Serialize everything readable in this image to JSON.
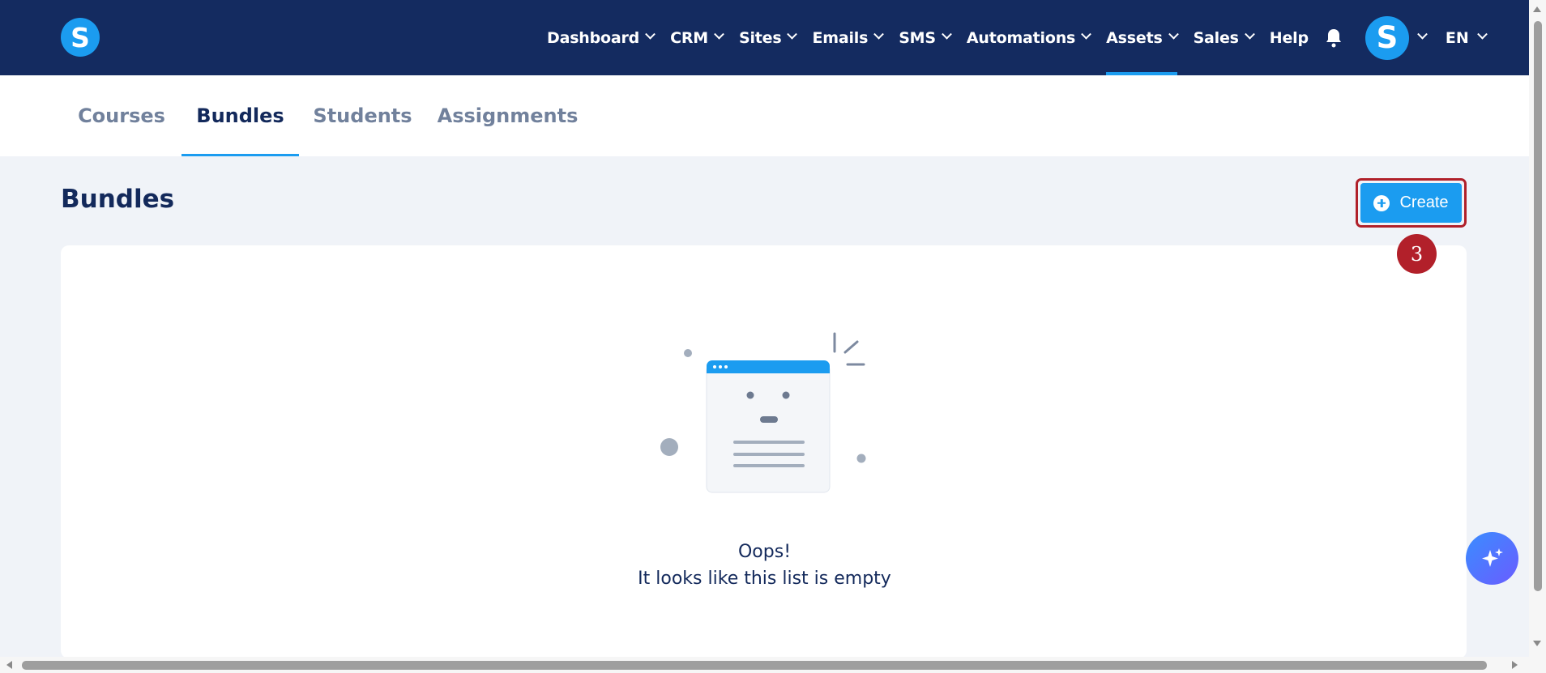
{
  "topbar": {
    "logo_letter": "S",
    "nav": [
      {
        "label": "Dashboard",
        "dropdown": true
      },
      {
        "label": "CRM",
        "dropdown": true
      },
      {
        "label": "Sites",
        "dropdown": true
      },
      {
        "label": "Emails",
        "dropdown": true
      },
      {
        "label": "SMS",
        "dropdown": true
      },
      {
        "label": "Automations",
        "dropdown": true
      },
      {
        "label": "Assets",
        "dropdown": true,
        "active": true
      },
      {
        "label": "Sales",
        "dropdown": true
      },
      {
        "label": "Help",
        "dropdown": false
      }
    ],
    "avatar_letter": "S",
    "language": "EN"
  },
  "subtabs": [
    {
      "label": "Courses",
      "active": false
    },
    {
      "label": "Bundles",
      "active": true
    },
    {
      "label": "Students",
      "active": false
    },
    {
      "label": "Assignments",
      "active": false
    }
  ],
  "page": {
    "title": "Bundles",
    "create_label": "Create",
    "step_badge": "3"
  },
  "empty_state": {
    "line1": "Oops!",
    "line2": "It looks like this list is empty"
  },
  "colors": {
    "topbar": "#142b60",
    "accent": "#1b9cf0",
    "badge": "#b2202a",
    "background": "#f0f3f8"
  }
}
